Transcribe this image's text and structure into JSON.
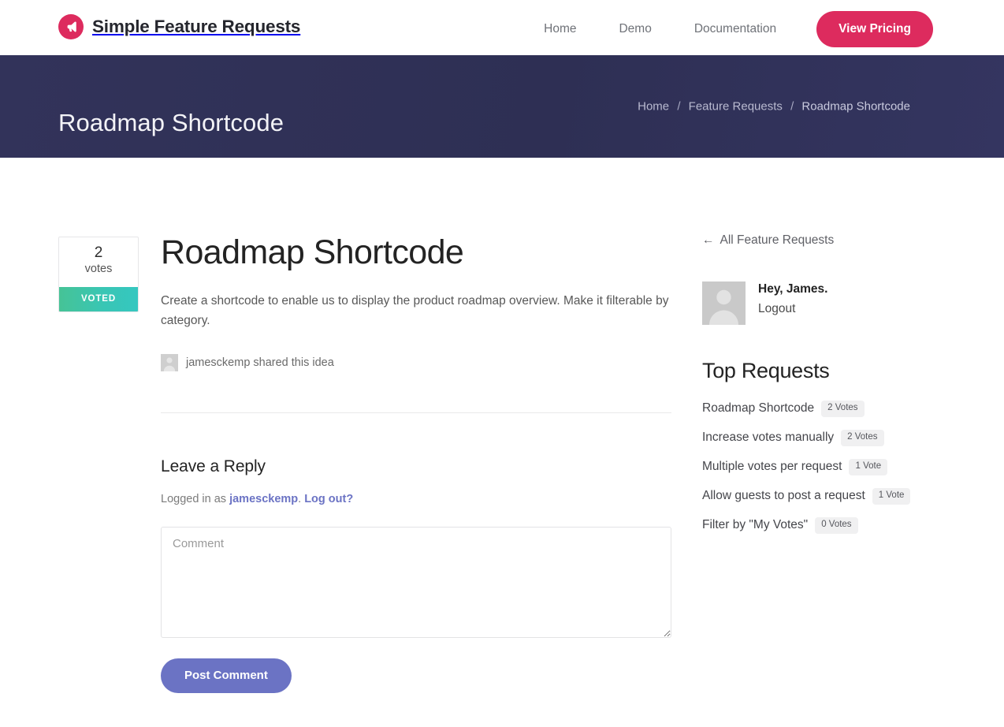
{
  "header": {
    "brand_name": "Simple Feature Requests",
    "logo_icon": "megaphone-icon",
    "logo_color": "#dd2b5e",
    "nav": [
      {
        "label": "Home"
      },
      {
        "label": "Demo"
      },
      {
        "label": "Documentation"
      }
    ],
    "cta_label": "View Pricing"
  },
  "hero": {
    "title": "Roadmap Shortcode",
    "background_color": "#2f3057",
    "breadcrumb": {
      "items": [
        {
          "label": "Home"
        },
        {
          "label": "Feature Requests"
        }
      ],
      "separator": "/",
      "current": "Roadmap Shortcode"
    }
  },
  "vote_box": {
    "count": "2",
    "count_label": "votes",
    "button_label": "VOTED",
    "button_gradient_from": "#46c396",
    "button_gradient_to": "#35c7c0"
  },
  "request": {
    "title": "Roadmap Shortcode",
    "body": "Create a shortcode to enable us to display the product roadmap overview. Make it filterable by category.",
    "byline": "jamesckemp shared this idea",
    "byline_avatar_icon": "user-avatar-icon"
  },
  "reply": {
    "heading": "Leave a Reply",
    "logged_in_prefix": "Logged in as ",
    "username": "jamesckemp",
    "logged_in_middle": ". ",
    "logout_label": "Log out?",
    "comment_placeholder": "Comment",
    "comment_value": "",
    "submit_label": "Post Comment",
    "submit_color": "#6b73c4"
  },
  "sidebar": {
    "back_link": "All Feature Requests",
    "back_arrow": "←",
    "user": {
      "greeting": "Hey, James.",
      "logout_label": "Logout",
      "avatar_icon": "user-avatar-icon"
    },
    "top_requests": {
      "heading": "Top Requests",
      "items": [
        {
          "label": "Roadmap Shortcode",
          "votes": "2 Votes"
        },
        {
          "label": "Increase votes manually",
          "votes": "2 Votes"
        },
        {
          "label": "Multiple votes per request",
          "votes": "1 Vote"
        },
        {
          "label": "Allow guests to post a request",
          "votes": "1 Vote"
        },
        {
          "label": "Filter by \"My Votes\"",
          "votes": "0 Votes"
        }
      ]
    }
  }
}
